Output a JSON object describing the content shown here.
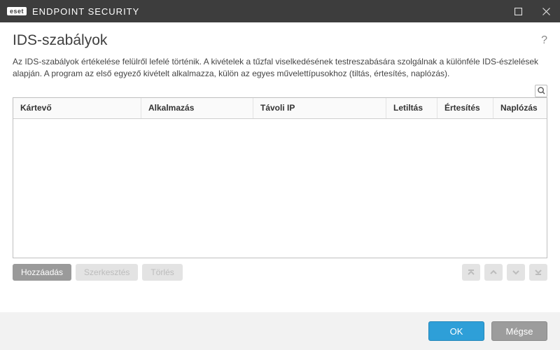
{
  "titlebar": {
    "badge": "eset",
    "product": "ENDPOINT SECURITY"
  },
  "page": {
    "title": "IDS-szabályok",
    "help": "?",
    "description": "Az IDS-szabályok értékelése felülről lefelé történik. A kivételek a tűzfal viselkedésének testreszabására szolgálnak a különféle IDS-észlelések alapján. A program az első egyező kivételt alkalmazza, külön az egyes művelettípusokhoz (tiltás, értesítés, naplózás)."
  },
  "table": {
    "columns": {
      "malware": "Kártevő",
      "app": "Alkalmazás",
      "remote_ip": "Távoli IP",
      "block": "Letiltás",
      "notify": "Értesítés",
      "log": "Naplózás"
    },
    "rows": []
  },
  "toolbar": {
    "add": "Hozzáadás",
    "edit": "Szerkesztés",
    "delete": "Törlés"
  },
  "footer": {
    "ok": "OK",
    "cancel": "Mégse"
  }
}
